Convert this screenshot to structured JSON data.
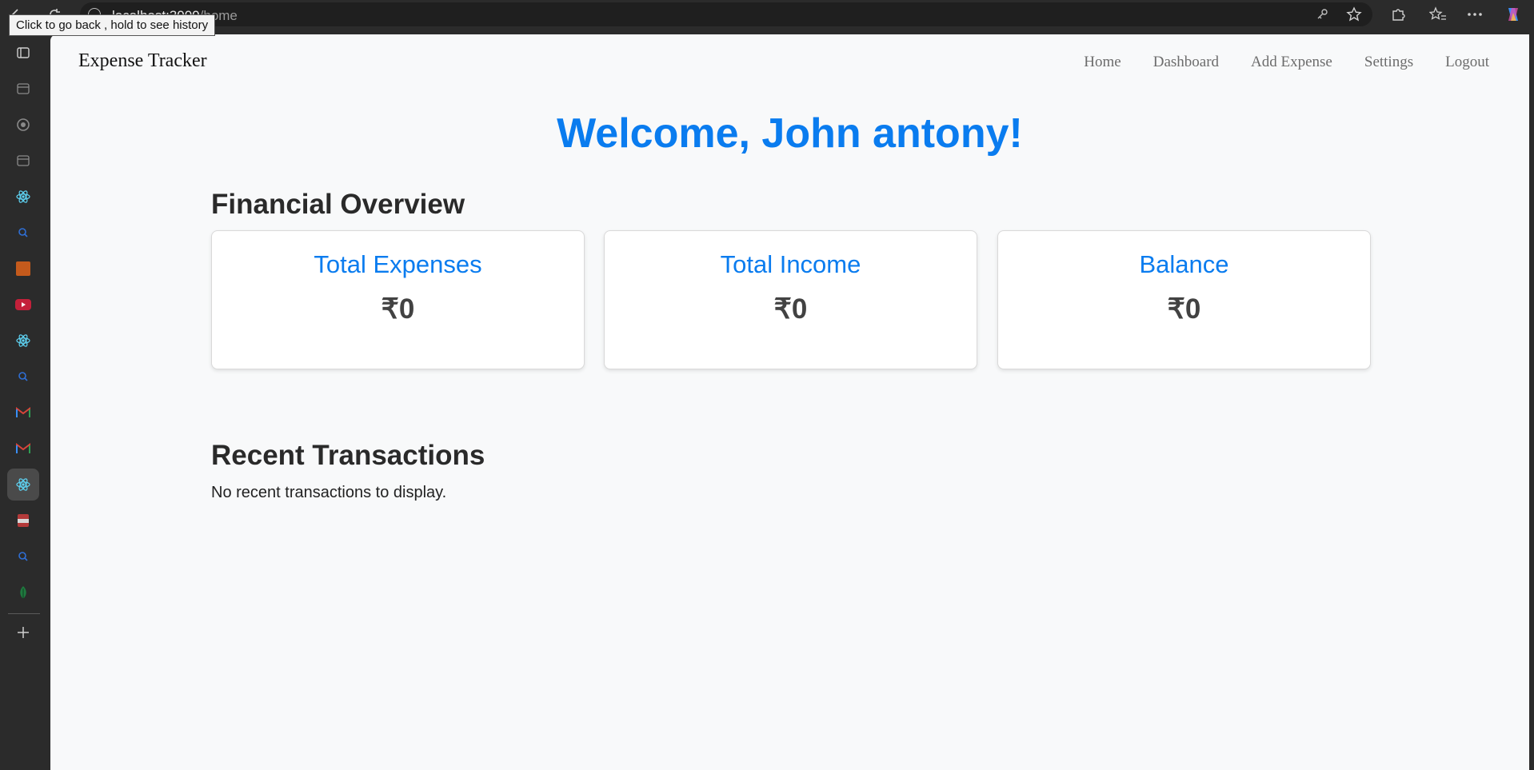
{
  "browser": {
    "url_host": "localhost:3000",
    "url_path": "/home",
    "tooltip": "Click to go back , hold to see history"
  },
  "tabs": [
    {
      "icon": "tab-actions-icon"
    },
    {
      "icon": "page-icon"
    },
    {
      "icon": "circle-icon"
    },
    {
      "icon": "page-icon"
    },
    {
      "icon": "react-icon"
    },
    {
      "icon": "search-icon"
    },
    {
      "icon": "orange-square-icon"
    },
    {
      "icon": "youtube-icon"
    },
    {
      "icon": "react-icon"
    },
    {
      "icon": "search-icon"
    },
    {
      "icon": "gmail-icon"
    },
    {
      "icon": "gmail-icon"
    },
    {
      "icon": "react-icon"
    },
    {
      "icon": "pdf-icon"
    },
    {
      "icon": "search-icon"
    },
    {
      "icon": "mongodb-leaf-icon"
    },
    {
      "icon": "new-tab-icon"
    }
  ],
  "app": {
    "brand": "Expense Tracker",
    "nav": {
      "home": "Home",
      "dashboard": "Dashboard",
      "add_expense": "Add Expense",
      "settings": "Settings",
      "logout": "Logout"
    },
    "welcome": "Welcome, John antony!",
    "overview_title": "Financial Overview",
    "cards": [
      {
        "title": "Total Expenses",
        "value": "₹0"
      },
      {
        "title": "Total Income",
        "value": "₹0"
      },
      {
        "title": "Balance",
        "value": "₹0"
      }
    ],
    "recent_title": "Recent Transactions",
    "recent_empty": "No recent transactions to display."
  },
  "colors": {
    "accent": "#0a7cef",
    "page_bg": "#f8f9fa",
    "chrome_bg": "#2b2b2b"
  }
}
